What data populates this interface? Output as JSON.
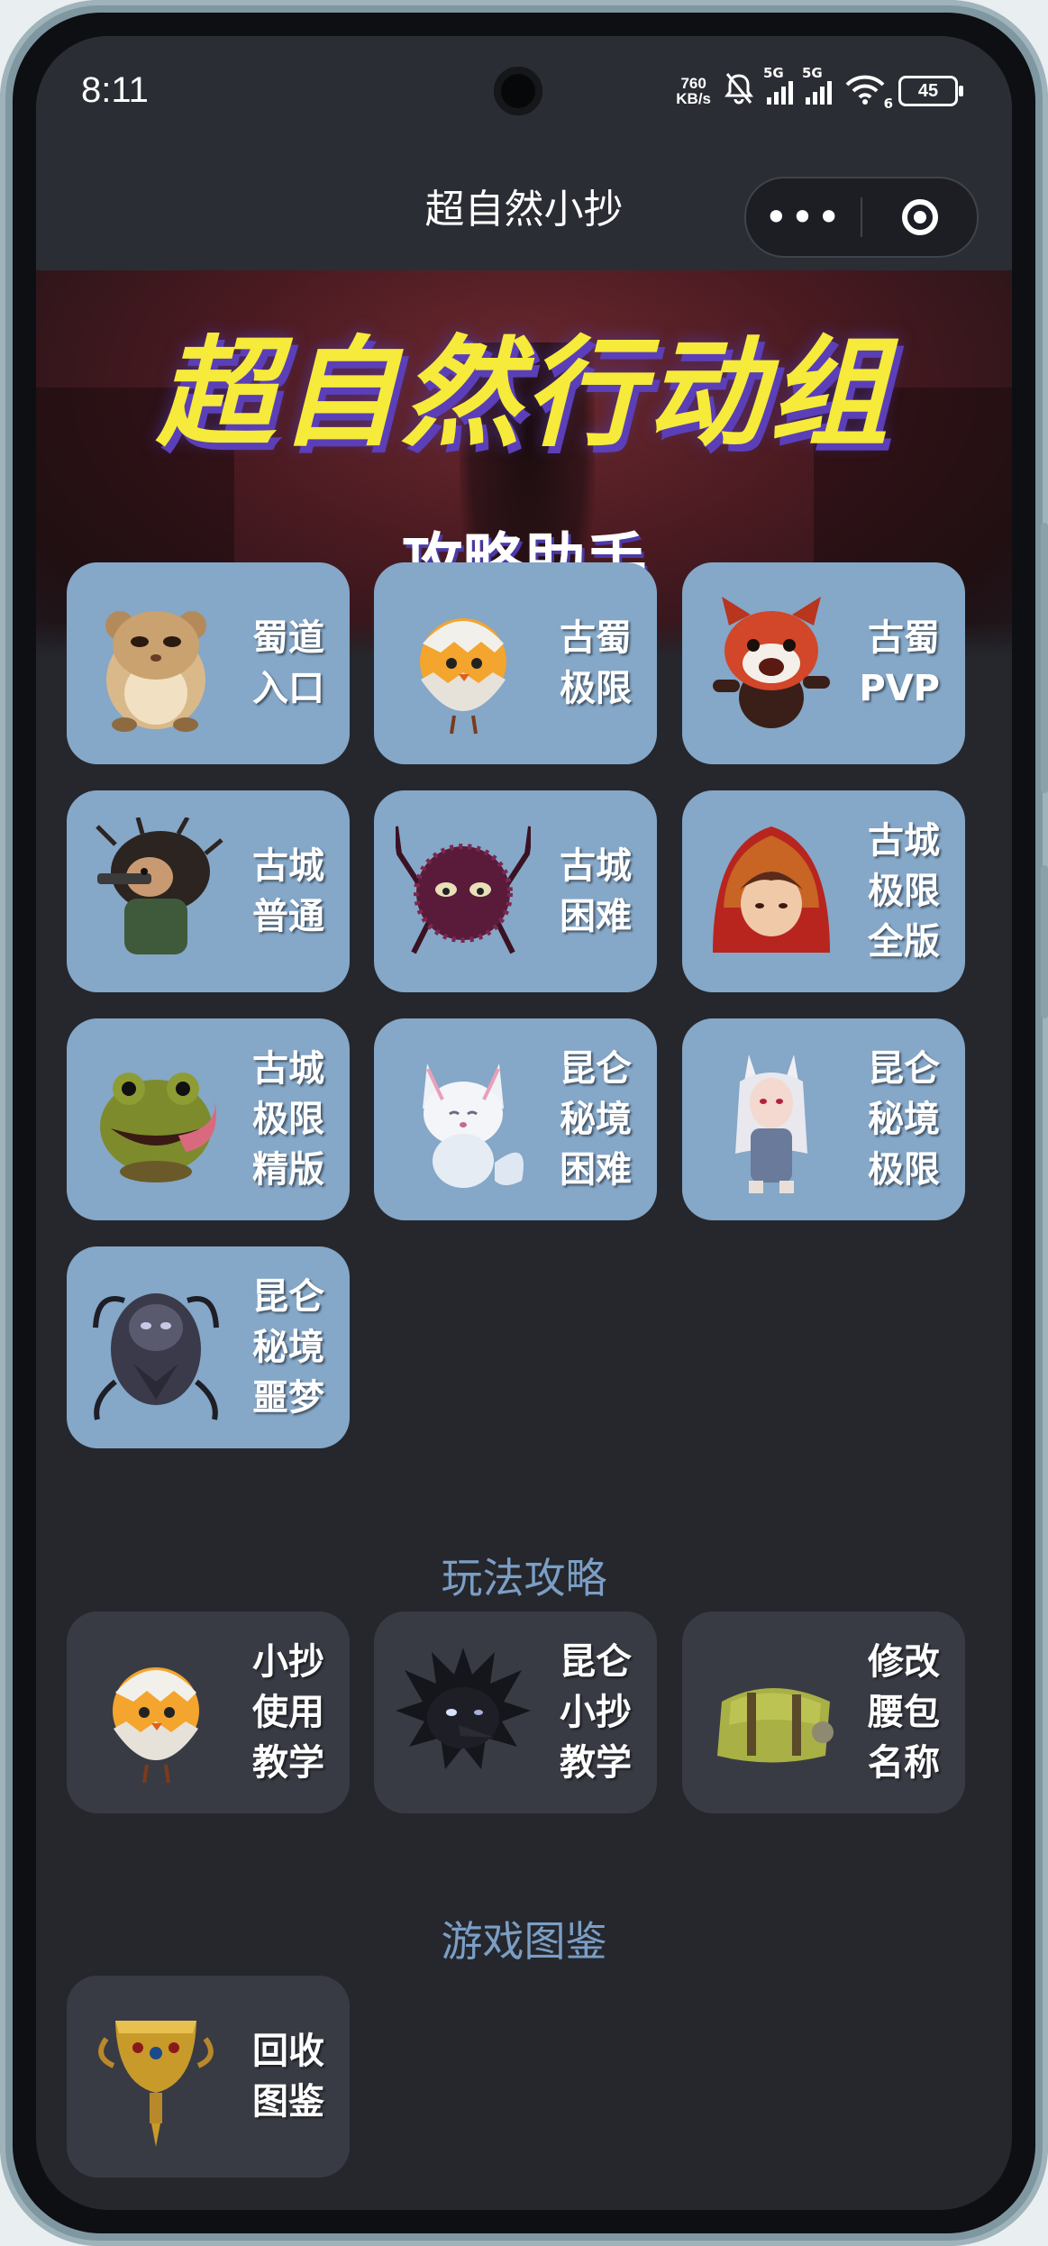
{
  "status_bar": {
    "time": "8:11",
    "net_speed_value": "760",
    "net_speed_unit": "KB/s",
    "sim1": "5G",
    "sim2": "5G",
    "wifi_badge": "6",
    "battery": "45"
  },
  "nav": {
    "title": "超自然小抄",
    "more_label": "•••"
  },
  "banner": {
    "title": "超自然行动组",
    "subtitle": "攻略助手"
  },
  "modes": [
    {
      "label": "蜀道\n入口",
      "icon": "hamster-icon"
    },
    {
      "label": "古蜀\n极限",
      "icon": "chick-egg-icon"
    },
    {
      "label": "古蜀\nPVP",
      "icon": "red-panda-icon"
    },
    {
      "label": "古城\n普通",
      "icon": "hedgehog-gunner-icon"
    },
    {
      "label": "古城\n困难",
      "icon": "spider-ball-icon"
    },
    {
      "label": "古城\n极限\n全版",
      "icon": "red-hood-girl-icon"
    },
    {
      "label": "古城\n极限\n精版",
      "icon": "frog-icon"
    },
    {
      "label": "昆仑\n秘境\n困难",
      "icon": "white-fox-icon"
    },
    {
      "label": "昆仑\n秘境\n极限",
      "icon": "fox-girl-icon"
    },
    {
      "label": "昆仑\n秘境\n噩梦",
      "icon": "dark-demon-icon"
    }
  ],
  "guides": {
    "title": "玩法攻略",
    "items": [
      {
        "label": "小抄\n使用\n教学",
        "icon": "chick-egg-icon"
      },
      {
        "label": "昆仑\n小抄\n教学",
        "icon": "black-crow-icon"
      },
      {
        "label": "修改\n腰包\n名称",
        "icon": "bag-icon"
      }
    ]
  },
  "atlas": {
    "title": "游戏图鉴",
    "items": [
      {
        "label": "回收\n图鉴",
        "icon": "golden-goblet-icon"
      }
    ]
  }
}
